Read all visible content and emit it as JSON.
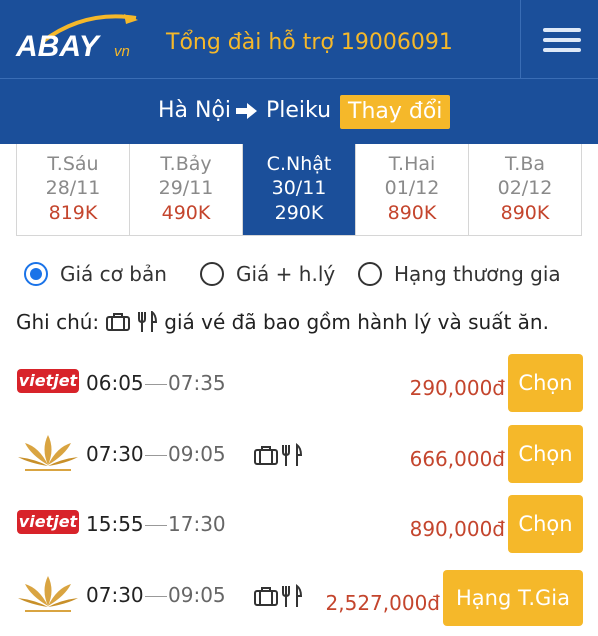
{
  "header": {
    "logo_text": "ABAY",
    "logo_suffix": "vn",
    "hotline": "Tổng đài hỗ trợ 19006091",
    "menu_icon": "hamburger-menu-icon",
    "brand_color": "#1b4f9a",
    "accent_color": "#f5b82a"
  },
  "route": {
    "from": "Hà Nội",
    "to": "Pleiku",
    "arrow_icon": "right-arrow-icon",
    "change_label": "Thay đổi"
  },
  "dates": [
    {
      "dow": "T.Sáu",
      "date": "28/11",
      "price": "819K",
      "active": false
    },
    {
      "dow": "T.Bảy",
      "date": "29/11",
      "price": "490K",
      "active": false
    },
    {
      "dow": "C.Nhật",
      "date": "30/11",
      "price": "290K",
      "active": true
    },
    {
      "dow": "T.Hai",
      "date": "01/12",
      "price": "890K",
      "active": false
    },
    {
      "dow": "T.Ba",
      "date": "02/12",
      "price": "890K",
      "active": false
    }
  ],
  "fare_options": [
    {
      "label": "Giá cơ bản",
      "selected": true
    },
    {
      "label": "Giá + h.lý",
      "selected": false
    },
    {
      "label": "Hạng thương gia",
      "selected": false
    }
  ],
  "note": {
    "prefix": "Ghi chú:",
    "text": "giá vé đã bao gồm hành lý và suất ăn.",
    "icons": [
      "luggage-icon",
      "meal-icon"
    ]
  },
  "flights": [
    {
      "airline": "vietjet",
      "airline_label": "vietjet",
      "depart": "06:05",
      "arrive": "07:35",
      "amenities": false,
      "price": "290,000đ",
      "button": "Chọn"
    },
    {
      "airline": "vietnam-airlines",
      "airline_label": "",
      "depart": "07:30",
      "arrive": "09:05",
      "amenities": true,
      "price": "666,000đ",
      "button": "Chọn"
    },
    {
      "airline": "vietjet",
      "airline_label": "vietjet",
      "depart": "15:55",
      "arrive": "17:30",
      "amenities": false,
      "price": "890,000đ",
      "button": "Chọn"
    },
    {
      "airline": "vietnam-airlines",
      "airline_label": "",
      "depart": "07:30",
      "arrive": "09:05",
      "amenities": true,
      "price": "2,527,000đ",
      "button": "Hạng T.Gia"
    }
  ]
}
